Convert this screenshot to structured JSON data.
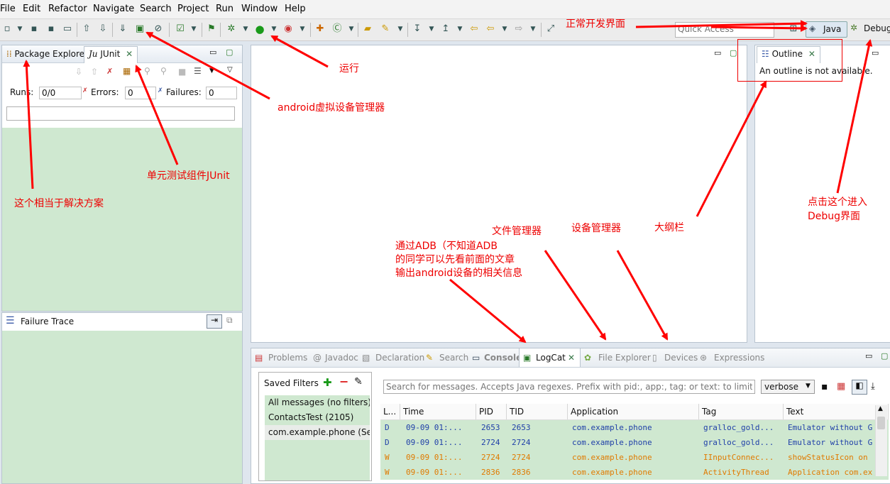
{
  "menu": [
    "File",
    "Edit",
    "Refactor",
    "Navigate",
    "Search",
    "Project",
    "Run",
    "Window",
    "Help"
  ],
  "toolbar": {
    "quick_access_placeholder": "Quick Access",
    "java_label": "Java",
    "debug_label": "Debug"
  },
  "left_tabs": {
    "package_explorer": "Package Explorer",
    "junit_prefix": "Ju",
    "junit": "JUnit"
  },
  "junit": {
    "runs_label": "Runs:",
    "runs_value": "0/0",
    "errors_label": "Errors:",
    "errors_value": "0",
    "failures_label": "Failures:",
    "failures_value": "0",
    "failure_trace": "Failure Trace"
  },
  "outline": {
    "tab": "Outline",
    "message": "An outline is not available."
  },
  "bottom_tabs": [
    "Problems",
    "Javadoc",
    "Declaration",
    "Search",
    "Console",
    "LogCat",
    "File Explorer",
    "Devices",
    "Expressions"
  ],
  "logcat": {
    "saved_filters_label": "Saved Filters",
    "filters": [
      "All messages (no filters)",
      "ContactsTest (2105)",
      "com.example.phone (Ses"
    ],
    "search_placeholder": "Search for messages. Accepts Java regexes. Prefix with pid:, app:, tag: or text: to limit sco",
    "level": "verbose",
    "columns": [
      "L...",
      "Time",
      "PID",
      "TID",
      "Application",
      "Tag",
      "Text"
    ],
    "rows": [
      {
        "level": "D",
        "time": "09-09 01:...",
        "pid": "2653",
        "tid": "2653",
        "app": "com.example.phone",
        "tag": "gralloc_gold...",
        "text": "Emulator without G",
        "color": "#1f3fa8"
      },
      {
        "level": "D",
        "time": "09-09 01:...",
        "pid": "2724",
        "tid": "2724",
        "app": "com.example.phone",
        "tag": "gralloc_gold...",
        "text": "Emulator without G",
        "color": "#1f3fa8"
      },
      {
        "level": "W",
        "time": "09-09 01:...",
        "pid": "2724",
        "tid": "2724",
        "app": "com.example.phone",
        "tag": "IInputConnec...",
        "text": "showStatusIcon on",
        "color": "#e07a00"
      },
      {
        "level": "W",
        "time": "09-09 01:...",
        "pid": "2836",
        "tid": "2836",
        "app": "com.example.phone",
        "tag": "ActivityThread",
        "text": "Application com.ex",
        "color": "#e07a00"
      }
    ]
  },
  "annotations": {
    "normal_dev": "正常开发界面",
    "run": "运行",
    "avd": "android虚拟设备管理器",
    "junit": "单元测试组件JUnit",
    "solution": "这个相当于解决方案",
    "debug1": "点击这个进入",
    "debug2": "Debug界面",
    "outline": "大纲栏",
    "devices": "设备管理器",
    "files": "文件管理器",
    "adb1": "通过ADB（不知道ADB",
    "adb2": "的同学可以先看前面的文章",
    "adb3": "输出android设备的相关信息"
  },
  "colors": {
    "annotation": "#ff0000",
    "panel_green": "#cfe8d0",
    "debug_blue": "#1f3fa8",
    "warn_orange": "#e07a00"
  }
}
